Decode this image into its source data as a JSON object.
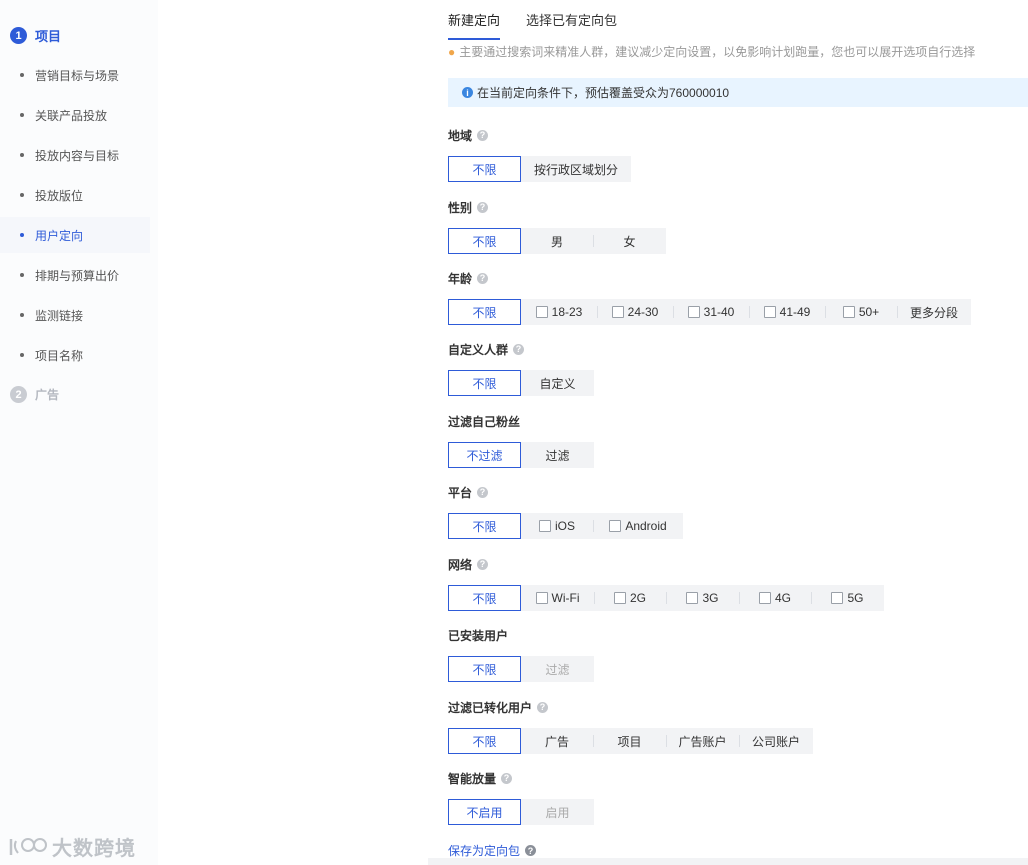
{
  "nav": {
    "step1": {
      "num": "1",
      "label": "项目"
    },
    "items": [
      {
        "label": "营销目标与场景"
      },
      {
        "label": "关联产品投放"
      },
      {
        "label": "投放内容与目标"
      },
      {
        "label": "投放版位"
      },
      {
        "label": "用户定向"
      },
      {
        "label": "排期与预算出价"
      },
      {
        "label": "监测链接"
      },
      {
        "label": "项目名称"
      }
    ],
    "current_index": 4,
    "step2": {
      "num": "2",
      "label": "广告"
    }
  },
  "watermark": "大数跨境",
  "tabs": [
    {
      "label": "新建定向"
    },
    {
      "label": "选择已有定向包"
    }
  ],
  "tip": "主要通过搜索词来精准人群，建议减少定向设置，以免影响计划跑量，您也可以展开选项自行选择",
  "coverage": "在当前定向条件下，预估覆盖受众为760000010",
  "sections": {
    "region": {
      "label": "地域",
      "options": [
        "不限",
        "按行政区域划分"
      ]
    },
    "gender": {
      "label": "性别",
      "options": [
        "不限",
        "男",
        "女"
      ]
    },
    "age": {
      "label": "年龄",
      "options": [
        "不限",
        "18-23",
        "24-30",
        "31-40",
        "41-49",
        "50+",
        "更多分段"
      ]
    },
    "custom": {
      "label": "自定义人群",
      "options": [
        "不限",
        "自定义"
      ]
    },
    "fans": {
      "label": "过滤自己粉丝",
      "options": [
        "不过滤",
        "过滤"
      ]
    },
    "platform": {
      "label": "平台",
      "options": [
        "不限",
        "iOS",
        "Android"
      ]
    },
    "network": {
      "label": "网络",
      "options": [
        "不限",
        "Wi-Fi",
        "2G",
        "3G",
        "4G",
        "5G"
      ]
    },
    "installed": {
      "label": "已安装用户",
      "options": [
        "不限",
        "过滤"
      ]
    },
    "converted": {
      "label": "过滤已转化用户",
      "options": [
        "不限",
        "广告",
        "项目",
        "广告账户",
        "公司账户"
      ]
    },
    "smart": {
      "label": "智能放量",
      "options": [
        "不启用",
        "启用"
      ]
    }
  },
  "save_link": "保存为定向包",
  "colors": {
    "accent": "#2e5bd8",
    "info_bg": "#e8f4ff"
  }
}
